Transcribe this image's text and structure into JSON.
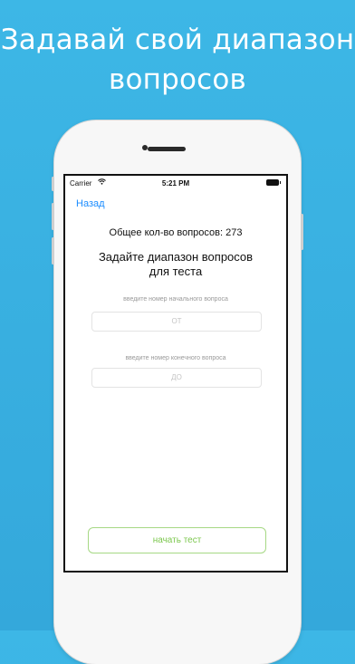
{
  "headline": {
    "line1": "Задавай свой диапазон",
    "line2": "вопросов"
  },
  "status_bar": {
    "carrier": "Carrier",
    "time": "5:21 PM"
  },
  "nav": {
    "back_label": "Назад"
  },
  "content": {
    "total_questions": "Общее кол-во вопросов: 273",
    "title_line1": "Задайте диапазон вопросов",
    "title_line2": "для теста",
    "start_hint": "введите номер начального вопроса",
    "start_placeholder": "от",
    "end_hint": "введите номер конечного вопроса",
    "end_placeholder": "до",
    "start_button": "начать тест"
  },
  "colors": {
    "background": "#3db7e6",
    "link": "#1a8cff",
    "button_accent": "#7cc74e"
  }
}
